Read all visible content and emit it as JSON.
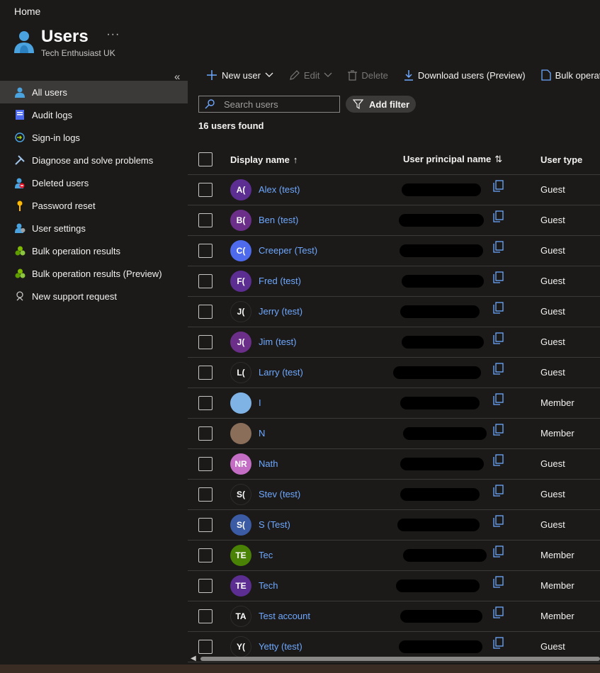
{
  "breadcrumb": "Home",
  "header": {
    "title": "Users",
    "subtitle": "Tech Enthusiast UK",
    "more": "···"
  },
  "sidebar": {
    "items": [
      {
        "label": "All users",
        "icon": "user-icon",
        "active": true
      },
      {
        "label": "Audit logs",
        "icon": "audit-log-icon"
      },
      {
        "label": "Sign-in logs",
        "icon": "sign-in-icon"
      },
      {
        "label": "Diagnose and solve problems",
        "icon": "wrench-icon"
      },
      {
        "label": "Deleted users",
        "icon": "deleted-user-icon"
      },
      {
        "label": "Password reset",
        "icon": "key-icon"
      },
      {
        "label": "User settings",
        "icon": "user-settings-icon"
      },
      {
        "label": "Bulk operation results",
        "icon": "bulk-icon"
      },
      {
        "label": "Bulk operation results (Preview)",
        "icon": "bulk-icon"
      },
      {
        "label": "New support request",
        "icon": "support-icon"
      }
    ]
  },
  "toolbar": {
    "new_user": "New user",
    "edit": "Edit",
    "delete": "Delete",
    "download": "Download users (Preview)",
    "bulk": "Bulk operatio"
  },
  "search": {
    "placeholder": "Search users"
  },
  "filter": {
    "label": "Add filter"
  },
  "results": {
    "count": "16 users found"
  },
  "table": {
    "headers": {
      "display_name": "Display name",
      "upn": "User principal name",
      "user_type": "User type"
    },
    "rows": [
      {
        "initials": "A(",
        "name": "Alex (test)",
        "type": "Guest",
        "avatar_color": "#5c2e91"
      },
      {
        "initials": "B(",
        "name": "Ben (test)",
        "type": "Guest",
        "avatar_color": "#6b2f8a"
      },
      {
        "initials": "C(",
        "name": "Creeper (Test)",
        "type": "Guest",
        "avatar_color": "#4f6bed"
      },
      {
        "initials": "F(",
        "name": "Fred (test)",
        "type": "Guest",
        "avatar_color": "#5c2e91"
      },
      {
        "initials": "J(",
        "name": "Jerry (test)",
        "type": "Guest",
        "avatar_color": ""
      },
      {
        "initials": "J(",
        "name": "Jim (test)",
        "type": "Guest",
        "avatar_color": "#6b2f8a"
      },
      {
        "initials": "L(",
        "name": "Larry (test)",
        "type": "Guest",
        "avatar_color": ""
      },
      {
        "initials": "",
        "name": "I",
        "type": "Member",
        "avatar_color": "#7fb3e6"
      },
      {
        "initials": "",
        "name": "N",
        "type": "Member",
        "avatar_color": "#8a6e5a"
      },
      {
        "initials": "NR",
        "name": "Nath",
        "type": "Guest",
        "avatar_color": "#c46dc4"
      },
      {
        "initials": "S(",
        "name": "Stev (test)",
        "type": "Guest",
        "avatar_color": ""
      },
      {
        "initials": "S(",
        "name": "S (Test)",
        "type": "Guest",
        "avatar_color": "#3b5ba5"
      },
      {
        "initials": "TE",
        "name": "Tec",
        "type": "Member",
        "avatar_color": "#498205"
      },
      {
        "initials": "TE",
        "name": "Tech",
        "type": "Member",
        "avatar_color": "#5c2e91"
      },
      {
        "initials": "TA",
        "name": "Test account",
        "type": "Member",
        "avatar_color": ""
      },
      {
        "initials": "Y(",
        "name": "Yetty (test)",
        "type": "Guest",
        "avatar_color": ""
      }
    ]
  }
}
